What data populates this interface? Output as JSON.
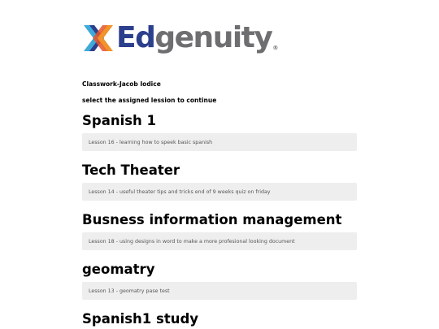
{
  "brand": {
    "name_part1": "Ed",
    "name_part2": "genuity",
    "registered_mark": "®",
    "logo_icon": "edgenuity-x-logo-icon",
    "colors": {
      "blue": "#2b3f8c",
      "orange": "#f0932b",
      "light_blue": "#3fa9d8",
      "gray": "#6e6e70"
    }
  },
  "header": {
    "classwork_label": "Classwork-Jacob Iodice",
    "instruction": "select the assigned lession to continue"
  },
  "courses": [
    {
      "title": "Spanish 1",
      "lesson": "Lesson 16 - learning how to speek basic spanish"
    },
    {
      "title": "Tech Theater",
      "lesson": "Lesson 14 - useful theater tips and tricks end of 9 weeks quiz on friday"
    },
    {
      "title": "Busness information management",
      "lesson": "Lesson 18 - using designs in word to make a more profesional looking document"
    },
    {
      "title": "geomatry",
      "lesson": "Lesson 13 - geomatry pase test"
    },
    {
      "title": "Spanish1 study",
      "lesson": ""
    }
  ]
}
